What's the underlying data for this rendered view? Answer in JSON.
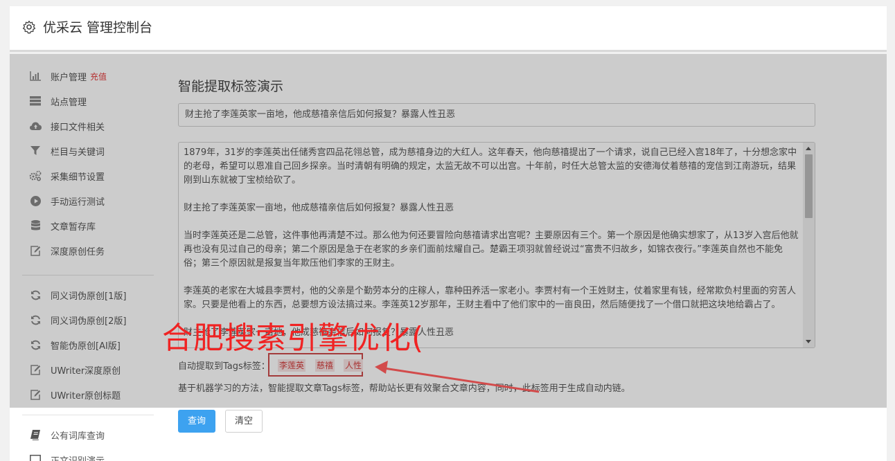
{
  "header": {
    "title": "优采云 管理控制台",
    "icon": "gear-icon"
  },
  "sidebar": {
    "items": [
      {
        "label": "账户管理",
        "badge": "充值",
        "icon": "bar-chart-icon"
      },
      {
        "label": "站点管理",
        "icon": "server-icon"
      },
      {
        "label": "接口文件相关",
        "icon": "cloud-upload-icon"
      },
      {
        "label": "栏目与关键词",
        "icon": "filter-icon"
      },
      {
        "label": "采集细节设置",
        "icon": "gears-icon"
      },
      {
        "label": "手动运行测试",
        "icon": "play-circle-icon"
      },
      {
        "label": "文章暂存库",
        "icon": "database-icon"
      },
      {
        "label": "深度原创任务",
        "icon": "edit-icon"
      },
      {
        "label": "同义词伪原创[1版]",
        "icon": "refresh-icon"
      },
      {
        "label": "同义词伪原创[2版]",
        "icon": "refresh-icon"
      },
      {
        "label": "智能伪原创[AI版]",
        "icon": "refresh-icon"
      },
      {
        "label": "UWriter深度原创",
        "icon": "edit-icon"
      },
      {
        "label": "UWriter原创标题",
        "icon": "edit-icon"
      },
      {
        "label": "公有词库查询",
        "icon": "book-icon"
      },
      {
        "label": "正文识别演示",
        "icon": "monitor-icon"
      }
    ]
  },
  "main": {
    "title": "智能提取标签演示",
    "title_input_value": "财主抢了李莲英家一亩地，他成慈禧亲信后如何报复？暴露人性丑恶",
    "body_paragraphs": [
      "1879年，31岁的李莲英出任储秀宫四品花翎总管，成为慈禧身边的大红人。这年春天，他向慈禧提出了一个请求，说自己已经入宫18年了，十分想念家中的老母，希望可以恩准自己回乡探亲。当时清朝有明确的规定，太监无故不可以出宫。十年前，时任大总管太监的安德海仗着慈禧的宠信到江南游玩，结果刚到山东就被丁宝桢给砍了。",
      "财主抢了李莲英家一亩地，他成慈禧亲信后如何报复？暴露人性丑恶",
      "当时李莲英还是二总管，这件事他再清楚不过。那么他为何还要冒险向慈禧请求出宫呢？主要原因有三个。第一个原因是他确实想家了，从13岁入宫后他就再也没有见过自己的母亲；第二个原因是急于在老家的乡亲们面前炫耀自己。楚霸王项羽就曾经说过“富贵不归故乡，如锦衣夜行。”李莲英自然也不能免俗；第三个原因就是报复当年欺压他们李家的王财主。",
      "李莲英的老家在大城县李贾村，他的父亲是个勤劳本分的庄稼人，靠种田养活一家老小。李贾村有一个王姓财主，仗着家里有钱，经常欺负村里面的穷苦人家。只要是他看上的东西，总要想方设法搞过来。李莲英12岁那年，王财主看中了他们家中的一亩良田，然后随便找了一个借口就把这块地给霸占了。",
      "财主抢了李莲英家一亩地，他成慈禧亲信后如何报复？暴露人性丑恶"
    ],
    "tags_label": "自动提取到Tags标签：",
    "tags": [
      "李莲英",
      "慈禧",
      "人性"
    ],
    "hint": "基于机器学习的方法，智能提取文章Tags标签，帮助站长更有效聚合文章内容，同时，此标签用于生成自动内链。",
    "query_button": "查询",
    "clear_button": "清空"
  },
  "watermark": {
    "text": "合肥搜索引擎优化("
  },
  "colors": {
    "accent": "#3da2f0",
    "tag_red": "#d23c3c",
    "annotation_red": "#cc4a4a"
  }
}
